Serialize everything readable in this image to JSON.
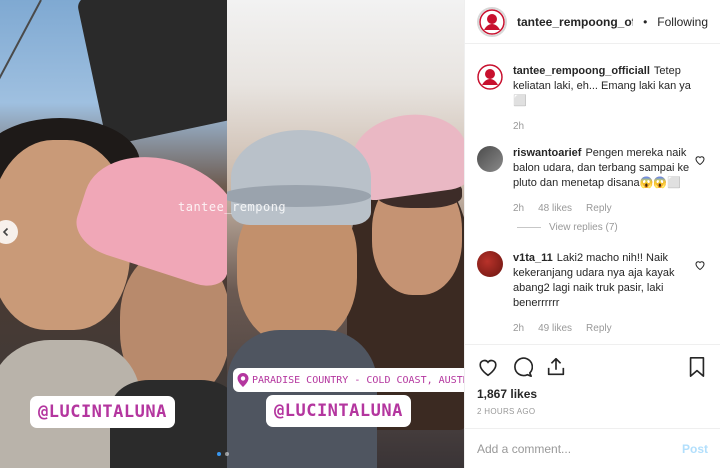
{
  "post": {
    "author": "tantee_rempoong_officiall",
    "header_user_display": "tantee_rempoong_offic",
    "follow_status": "Following",
    "separator": "•",
    "caption_user": "tantee_rempoong_officiall",
    "caption_text": "Tetep keliatan laki, eh... Emang laki kan ya",
    "caption_emoji": "⬜",
    "caption_age": "2h",
    "likes": "1,867 likes",
    "posted_ago": "2 HOURS AGO"
  },
  "media": {
    "watermark": "tantee_rempong",
    "location_sticker": "PARADISE COUNTRY - COLD COAST, AUSTRALIA",
    "mention_left": "@LUCINTALUNA",
    "mention_right": "@LUCINTALUNA",
    "slides_total": 2,
    "slide_active": 1
  },
  "comments": [
    {
      "user": "riswantoarief",
      "text": "Pengen mereka naik balon udara, dan terbang sampai ke pluto dan menetap disana😱😱⬜",
      "age": "2h",
      "likes": "48 likes",
      "reply": "Reply",
      "view_replies": "View replies (7)"
    },
    {
      "user": "v1ta_11",
      "text": "Laki2 macho nih!! Naik kekeranjang udara nya aja kayak abang2 lagi naik truk pasir, laki benerrrrrr",
      "age": "2h",
      "likes": "49 likes",
      "reply": "Reply"
    }
  ],
  "add_comment": {
    "placeholder": "Add a comment...",
    "post_label": "Post"
  },
  "colors": {
    "sticker_text": "#b4369f",
    "post_disabled": "#b2dffc",
    "muted": "#999999",
    "dot_active": "#3897f0"
  },
  "icons": {
    "like": "heart-icon",
    "comment": "comment-icon",
    "share": "share-icon",
    "save": "bookmark-icon",
    "prev": "chevron-left-icon",
    "location": "pin-icon"
  }
}
